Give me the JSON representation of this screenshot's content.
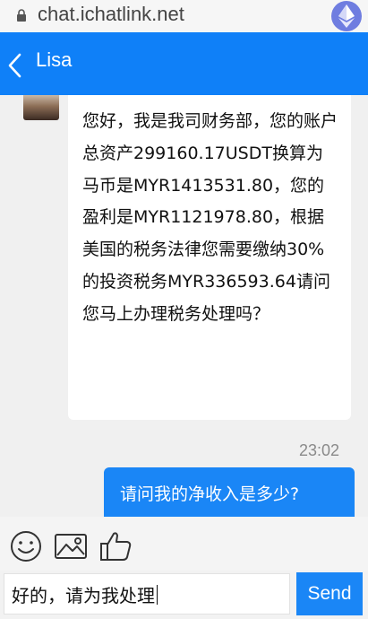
{
  "browser": {
    "url": "chat.ichatlink.net"
  },
  "header": {
    "title": "Lisa"
  },
  "messages": [
    {
      "direction": "incoming",
      "text": "您好，我是我司财务部，您的账户总资产299160.17USDT换算为马币是MYR1413531.80，您的盈利是MYR1121978.80，根据美国的税务法律您需要缴纳30%的投资税务MYR336593.64请问您马上办理税务处理吗？"
    },
    {
      "direction": "outgoing",
      "time": "23:02",
      "text": "请问我的净收入是多少?"
    }
  ],
  "composer": {
    "value": "好的，请为我处理",
    "send_label": "Send"
  },
  "colors": {
    "accent": "#0f80f8",
    "bubble_out": "#1a86f6",
    "background": "#f0f0f0"
  },
  "icons": [
    "lock-icon",
    "ethereum-icon",
    "back-arrow-icon",
    "emoji-icon",
    "image-icon",
    "thumbs-up-icon"
  ]
}
